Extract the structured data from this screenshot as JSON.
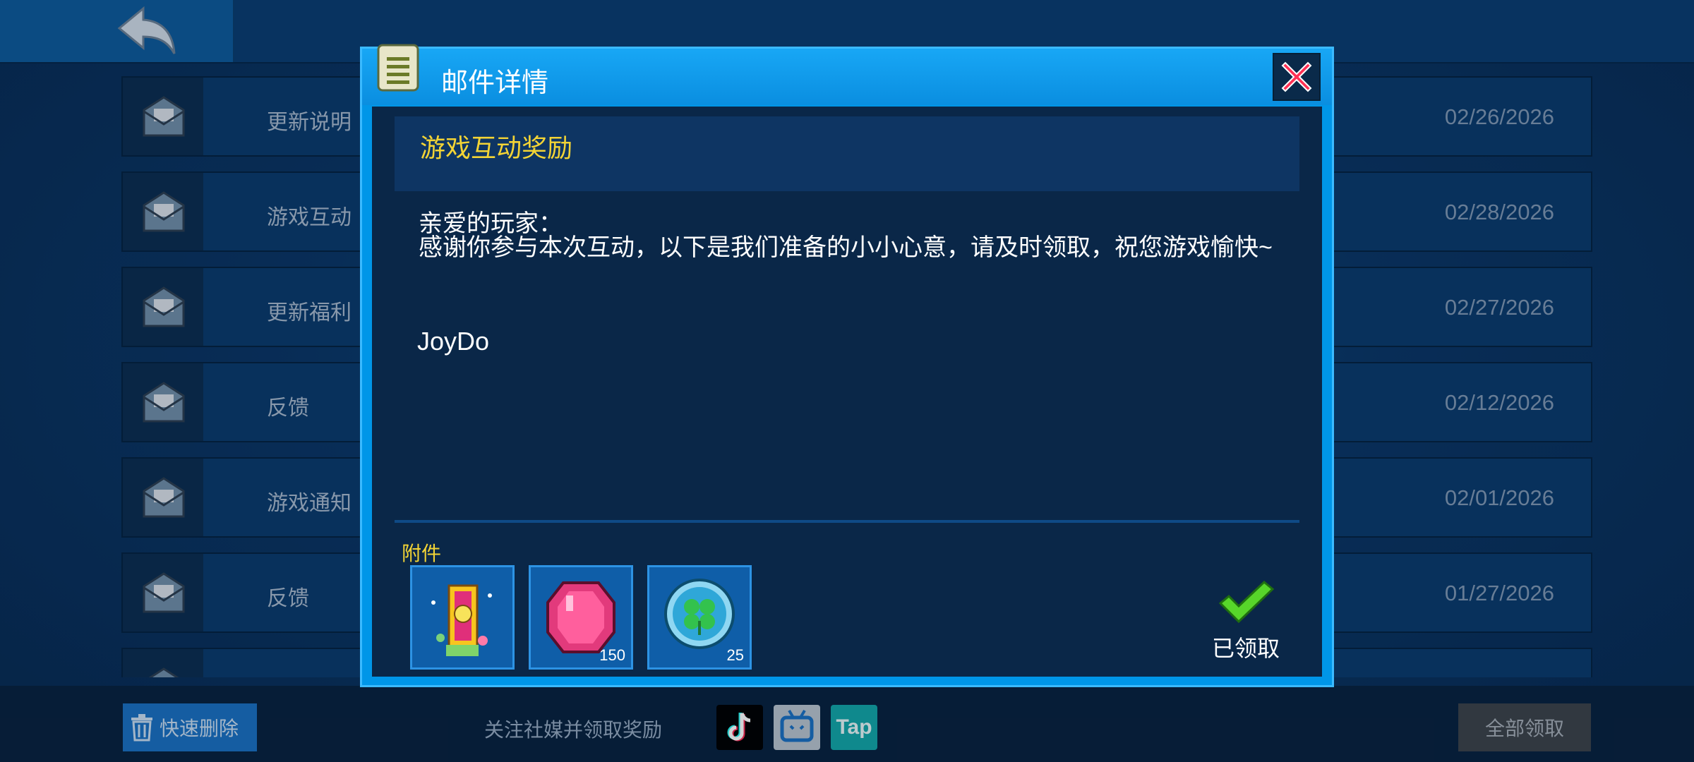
{
  "topbar": {
    "back_icon": "back-arrow-icon"
  },
  "mails": [
    {
      "title": "更新说明",
      "date": "02/26/2026"
    },
    {
      "title": "游戏互动",
      "date": "02/28/2026"
    },
    {
      "title": "更新福利",
      "date": "02/27/2026"
    },
    {
      "title": "反馈",
      "date": "02/12/2026"
    },
    {
      "title": "游戏通知",
      "date": "02/01/2026"
    },
    {
      "title": "反馈",
      "date": "01/27/2026"
    }
  ],
  "bottom": {
    "quick_delete": "快速删除",
    "social_text": "关注社媒并领取奖励",
    "social": [
      "TikTok",
      "Bilibili",
      "Tap"
    ],
    "claim_all": "全部领取"
  },
  "dialog": {
    "title": "邮件详情",
    "subject": "游戏互动奖励",
    "greeting": "亲爱的玩家：",
    "message": "感谢你参与本次互动，以下是我们准备的小小心意，请及时领取，祝您游戏愉快~",
    "signature": "JoyDo",
    "attachments_label": "附件",
    "attachments": [
      {
        "name": "30-day-card-icon",
        "qty": ""
      },
      {
        "name": "pink-gem-icon",
        "qty": "150"
      },
      {
        "name": "clover-coin-icon",
        "qty": "25"
      }
    ],
    "claimed_label": "已领取"
  },
  "colors": {
    "accent": "#0096e8",
    "subject": "#f3d435",
    "panel": "#0a2748"
  }
}
